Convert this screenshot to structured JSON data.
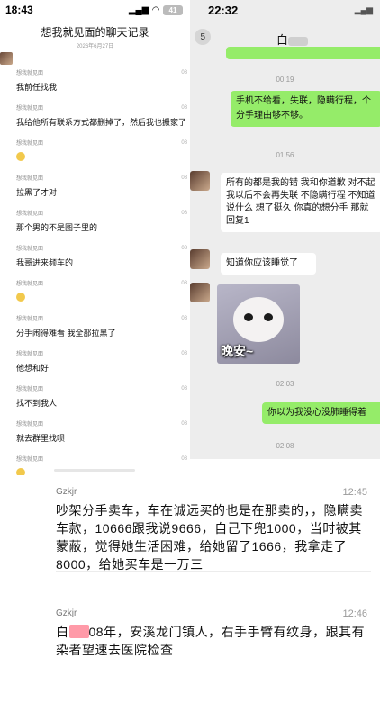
{
  "left_status": {
    "time": "18:43",
    "battery": "41"
  },
  "history": {
    "title": "想我就见面的聊天记录",
    "date": "2026年6月27日",
    "messages": [
      {
        "sender": "想我就见面",
        "time": "08",
        "text": "我前任找我"
      },
      {
        "sender": "想我就见面",
        "time": "08",
        "text": "我给他所有联系方式都删掉了，然后我也搬家了"
      },
      {
        "sender": "想我就见面",
        "time": "08",
        "text": ""
      },
      {
        "sender": "想我就见面",
        "time": "08",
        "text": "拉黑了才对"
      },
      {
        "sender": "想我就见面",
        "time": "08",
        "text": "那个男的不是图子里的"
      },
      {
        "sender": "想我就见面",
        "time": "08",
        "text": "我哥进来频车的"
      },
      {
        "sender": "想我就见面",
        "time": "08",
        "text": ""
      },
      {
        "sender": "想我就见面",
        "time": "08",
        "text": "分手闹得难看 我全部拉黑了"
      },
      {
        "sender": "想我就见面",
        "time": "08",
        "text": "他想和好"
      },
      {
        "sender": "想我就见面",
        "time": "08",
        "text": "找不到我人"
      },
      {
        "sender": "想我就见面",
        "time": "08",
        "text": "就去群里找呗"
      },
      {
        "sender": "想我就见面",
        "time": "08",
        "text": ""
      }
    ]
  },
  "right_status": {
    "time": "22:32"
  },
  "chat": {
    "back_count": "5",
    "name": "白",
    "timestamps": [
      "00:19",
      "01:56",
      "02:03",
      "02:08"
    ],
    "msg_out_1": "手机不给看，失联，隐瞒行程，个分手理由够不够。",
    "msg_in_1": "所有的都是我的错 我和你道歉 对不起 我以后不会再失联 不隐瞒行程 不知道说什么 想了挺久 你真的想分手 那就回复1",
    "msg_in_2": "知道你应该睡觉了",
    "sticker_caption": "晚安~",
    "msg_out_2": "你以为我没心没肺睡得着"
  },
  "comments": [
    {
      "user": "Gzkjr",
      "time": "12:45",
      "text": "吵架分手卖车，车在诚远买的也是在那卖的，，隐瞒卖车款，10666跟我说9666，自己下兜1000，当时被其蒙蔽，觉得她生活困难，给她留了1666，我拿走了8000，给她买车是一万三"
    },
    {
      "user": "Gzkjr",
      "time": "12:46",
      "text_prefix": "白",
      "text_rest": "08年，安溪龙门镇人，右手手臂有纹身，跟其有染者望速去医院检查"
    }
  ]
}
